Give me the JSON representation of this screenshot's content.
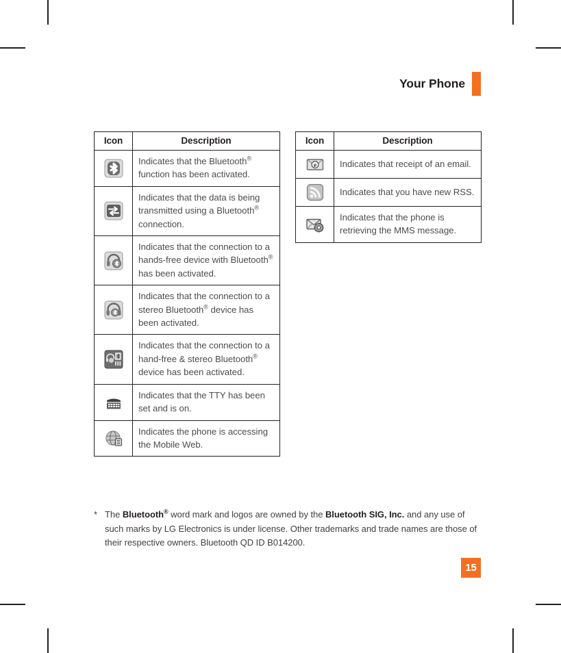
{
  "header": {
    "title": "Your Phone",
    "accent_color": "#f37021"
  },
  "tables": {
    "columns": {
      "icon": "Icon",
      "description": "Description"
    },
    "left_rows": [
      {
        "icon": "bluetooth-icon",
        "description_parts": [
          {
            "t": "Indicates that the Bluetooth"
          },
          {
            "t": "®",
            "sup": true
          },
          {
            "t": " function has been activated."
          }
        ],
        "description": "Indicates that the Bluetooth® function has been activated."
      },
      {
        "icon": "bluetooth-data-transfer-icon",
        "description_parts": [
          {
            "t": "Indicates that the data is being transmitted using a Bluetooth"
          },
          {
            "t": "®",
            "sup": true
          },
          {
            "t": " connection."
          }
        ],
        "description": "Indicates that the data is being transmitted using a Bluetooth® connection."
      },
      {
        "icon": "bluetooth-handsfree-icon",
        "description_parts": [
          {
            "t": "Indicates that the connection to a hands-free device with Bluetooth"
          },
          {
            "t": "®",
            "sup": true
          },
          {
            "t": " has been activated."
          }
        ],
        "description": "Indicates that the connection to a hands-free device with Bluetooth® has been activated."
      },
      {
        "icon": "bluetooth-stereo-headset-icon",
        "description_parts": [
          {
            "t": "Indicates that the connection to a stereo Bluetooth"
          },
          {
            "t": "®",
            "sup": true
          },
          {
            "t": " device has been activated."
          }
        ],
        "description": "Indicates that the connection to a stereo Bluetooth® device has been activated."
      },
      {
        "icon": "bluetooth-handsfree-stereo-icon",
        "description_parts": [
          {
            "t": "Indicates that the connection to a hand-free & stereo Bluetooth"
          },
          {
            "t": "®",
            "sup": true
          },
          {
            "t": " device has been activated."
          }
        ],
        "description": "Indicates that the connection to a hand-free & stereo Bluetooth® device has been activated."
      },
      {
        "icon": "tty-icon",
        "description_parts": [
          {
            "t": "Indicates that the TTY has been set and is on."
          }
        ],
        "description": "Indicates that the TTY has been set and is on."
      },
      {
        "icon": "mobile-web-globe-icon",
        "description_parts": [
          {
            "t": "Indicates the phone is accessing the Mobile Web."
          }
        ],
        "description": "Indicates the phone is accessing the Mobile Web."
      }
    ],
    "right_rows": [
      {
        "icon": "email-envelope-icon",
        "description_parts": [
          {
            "t": "Indicates that receipt of an email."
          }
        ],
        "description": "Indicates that receipt of an email."
      },
      {
        "icon": "rss-feed-icon",
        "description_parts": [
          {
            "t": "Indicates that you have new RSS."
          }
        ],
        "description": "Indicates that you have new RSS."
      },
      {
        "icon": "mms-retrieving-icon",
        "description_parts": [
          {
            "t": "Indicates that the phone is retrieving the MMS message."
          }
        ],
        "description": "Indicates that the phone is retrieving the MMS message."
      }
    ]
  },
  "footnote": {
    "marker": "*",
    "parts": [
      {
        "t": "The "
      },
      {
        "t": "Bluetooth",
        "bold": true
      },
      {
        "t": "®",
        "bold": true,
        "sup": true
      },
      {
        "t": " word mark and logos are owned by the "
      },
      {
        "t": "Bluetooth SIG, Inc.",
        "bold": true
      },
      {
        "t": " and any use of such marks by LG Electronics is under license. Other trademarks and trade names are those of their respective owners. Bluetooth QD ID B014200."
      }
    ],
    "text": "* The Bluetooth® word mark and logos are owned by the Bluetooth SIG, Inc. and any use of such marks by LG Electronics is under license. Other trademarks and trade names are those of their respective owners. Bluetooth QD ID B014200."
  },
  "page_number": "15"
}
